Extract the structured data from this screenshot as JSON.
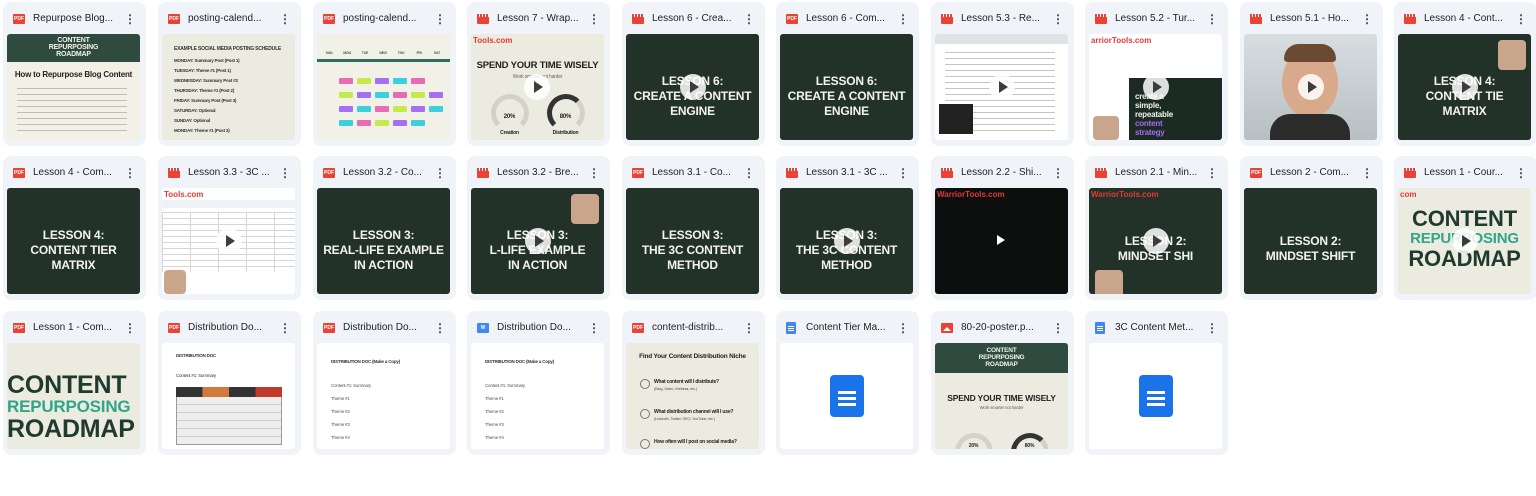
{
  "colors": {
    "card_bg": "#f0f4f9",
    "pdf_red": "#ea4335",
    "doc_blue": "#1a73e8",
    "dark_green": "#233229",
    "cream": "#ecebdf"
  },
  "files": [
    {
      "title": "Repurpose Blog...",
      "type": "pdf",
      "icon": "pdf-icon",
      "thumb": {
        "kind": "doc_green",
        "lines": [
          "CONTENT",
          "REPURPOSING",
          "ROADMAP"
        ],
        "heading": "How to Repurpose Blog Content"
      }
    },
    {
      "title": "posting-calend...",
      "type": "pdf",
      "icon": "pdf-icon",
      "thumb": {
        "kind": "schedule",
        "heading": "EXAMPLE SOCIAL MEDIA POSTING SCHEDULE",
        "rows": [
          "MONDAY: Summary Post (Post 1)",
          "TUESDAY: Theme #1 (Post 1)",
          "WEDNESDAY: Summary Post #2",
          "THURSDAY: Theme #1 (Post 2)",
          "FRIDAY: Summary Post (Post 3)",
          "SATURDAY: Optional",
          "SUNDAY: Optional",
          "MONDAY: Theme #1 (Post 3)"
        ]
      }
    },
    {
      "title": "posting-calend...",
      "type": "pdf",
      "icon": "pdf-icon",
      "thumb": {
        "kind": "calendar",
        "days": [
          "SUN",
          "MON",
          "TUE",
          "WED",
          "THU",
          "FRI",
          "SAT"
        ]
      }
    },
    {
      "title": "Lesson 7 - Wrap...",
      "type": "video",
      "icon": "video-icon",
      "thumb": {
        "kind": "spend",
        "brand": "Tools.com",
        "heading": "SPEND YOUR TIME WISELY",
        "sub": "Work smarter not harder",
        "left_pct": "20%",
        "right_pct": "80%",
        "left_label": "Creation",
        "right_label": "Distribution"
      }
    },
    {
      "title": "Lesson 6 - Crea...",
      "type": "video",
      "icon": "video-icon",
      "thumb": {
        "kind": "lesson_dark",
        "lines": [
          "LESSON 6:",
          "CREATE A CONTENT",
          "ENGINE"
        ],
        "play": true
      }
    },
    {
      "title": "Lesson 6 - Com...",
      "type": "pdf",
      "icon": "pdf-icon",
      "thumb": {
        "kind": "lesson_dark",
        "lines": [
          "LESSON 6:",
          "CREATE A CONTENT",
          "ENGINE"
        ],
        "play": false
      }
    },
    {
      "title": "Lesson 5.3 - Re...",
      "type": "video",
      "icon": "video-icon",
      "thumb": {
        "kind": "screen_recording",
        "play": true
      }
    },
    {
      "title": "Lesson 5.2 - Tur...",
      "type": "video",
      "icon": "video-icon",
      "thumb": {
        "kind": "strategy",
        "brand": "arriorTools.com",
        "lines": [
          "create a",
          "simple,",
          "repeatable"
        ],
        "accent": [
          "content",
          "strategy"
        ]
      }
    },
    {
      "title": "Lesson 5.1 - Ho...",
      "type": "video",
      "icon": "video-icon",
      "thumb": {
        "kind": "presenter",
        "play": true
      }
    },
    {
      "title": "Lesson 4 - Cont...",
      "type": "video",
      "icon": "video-icon",
      "thumb": {
        "kind": "lesson_dark_face",
        "lines": [
          "LESSON 4:",
          "CONTENT TIE",
          "MATRIX"
        ],
        "play": true
      }
    },
    {
      "title": "Lesson 4 - Com...",
      "type": "pdf",
      "icon": "pdf-icon",
      "thumb": {
        "kind": "lesson_dark",
        "lines": [
          "LESSON 4:",
          "CONTENT TIER",
          "MATRIX"
        ],
        "play": false
      }
    },
    {
      "title": "Lesson 3.3 - 3C ...",
      "type": "video",
      "icon": "video-icon",
      "thumb": {
        "kind": "spreadsheet",
        "brand": "Tools.com",
        "play": true
      }
    },
    {
      "title": "Lesson 3.2 - Co...",
      "type": "pdf",
      "icon": "pdf-icon",
      "thumb": {
        "kind": "lesson_dark",
        "lines": [
          "LESSON 3:",
          "REAL-LIFE EXAMPLE",
          "IN ACTION"
        ],
        "play": false
      }
    },
    {
      "title": "Lesson 3.2 - Bre...",
      "type": "video",
      "icon": "video-icon",
      "thumb": {
        "kind": "lesson_dark_face",
        "lines": [
          "LESSON 3:",
          "L-LIFE EXAMPLE",
          "IN ACTION"
        ],
        "play": true
      }
    },
    {
      "title": "Lesson 3.1 - Co...",
      "type": "pdf",
      "icon": "pdf-icon",
      "thumb": {
        "kind": "lesson_dark",
        "lines": [
          "LESSON 3:",
          "THE 3C CONTENT",
          "METHOD"
        ],
        "play": false
      }
    },
    {
      "title": "Lesson 3.1 - 3C ...",
      "type": "video",
      "icon": "video-icon",
      "thumb": {
        "kind": "lesson_dark",
        "lines": [
          "LESSON 3:",
          "THE 3C CONTENT",
          "METHOD"
        ],
        "play": true
      }
    },
    {
      "title": "Lesson 2.2 - Shi...",
      "type": "video",
      "icon": "video-icon",
      "thumb": {
        "kind": "black_video",
        "brand": "WarriorTools.com",
        "play": true
      }
    },
    {
      "title": "Lesson 2.1 - Min...",
      "type": "video",
      "icon": "video-icon",
      "thumb": {
        "kind": "lesson_dark_face",
        "brand": "WarriorTools.com",
        "lines": [
          "LESSON 2:",
          "MINDSET SHI"
        ],
        "play": true
      }
    },
    {
      "title": "Lesson 2 - Com...",
      "type": "pdf",
      "icon": "pdf-icon",
      "thumb": {
        "kind": "lesson_dark",
        "lines": [
          "LESSON 2:",
          "MINDSET SHIFT"
        ],
        "play": false
      }
    },
    {
      "title": "Lesson 1 - Cour...",
      "type": "video",
      "icon": "video-icon",
      "thumb": {
        "kind": "roadmap",
        "brand": "com",
        "lines": [
          "CONTENT",
          "REPURPOSING",
          "ROADMAP"
        ],
        "play": true
      }
    },
    {
      "title": "Lesson 1 - Com...",
      "type": "pdf",
      "icon": "pdf-icon",
      "thumb": {
        "kind": "roadmap_big",
        "lines": [
          "CONTENT",
          "REPURPOSING",
          "ROADMAP"
        ],
        "play": false
      }
    },
    {
      "title": "Distribution Do...",
      "type": "pdf",
      "icon": "pdf-icon",
      "thumb": {
        "kind": "dist_table",
        "heading": "DISTRIBUTION DOC",
        "sub": "Content #1: Summary"
      }
    },
    {
      "title": "Distribution Do...",
      "type": "pdf",
      "icon": "pdf-icon",
      "thumb": {
        "kind": "dist_doc",
        "heading": "DISTRIBUTION DOC (Make a Copy)",
        "rows": [
          "Content #1: Summary",
          "Theme #1",
          "Theme #2",
          "Theme #3",
          "Theme #4"
        ]
      }
    },
    {
      "title": "Distribution Do...",
      "type": "word",
      "icon": "word-icon",
      "thumb": {
        "kind": "dist_doc",
        "heading": "DISTRIBUTION DOC (Make a Copy)",
        "rows": [
          "Content #1: Summary",
          "Theme #1",
          "Theme #2",
          "Theme #3",
          "Theme #4"
        ]
      }
    },
    {
      "title": "content-distrib...",
      "type": "pdf",
      "icon": "pdf-icon",
      "thumb": {
        "kind": "niche",
        "heading": "Find Your Content Distribution Niche",
        "questions": [
          "What content will I distribute?",
          "What distribution channel will I use?",
          "How often will I post on social media?"
        ],
        "hints": [
          "(Blog, Video, Webinar, etc.)",
          "(LinkedIn, Twitter, SEO, YouTube, etc.)",
          ""
        ]
      }
    },
    {
      "title": "Content Tier Ma...",
      "type": "doc",
      "icon": "doc-icon",
      "thumb": {
        "kind": "doc_placeholder"
      }
    },
    {
      "title": "80-20-poster.p...",
      "type": "image",
      "icon": "image-icon",
      "thumb": {
        "kind": "poster",
        "lines": [
          "CONTENT",
          "REPURPOSING",
          "ROADMAP"
        ],
        "heading": "SPEND YOUR TIME WISELY",
        "sub": "Work smarter not harder",
        "left_pct": "20%",
        "right_pct": "80%"
      }
    },
    {
      "title": "3C Content Met...",
      "type": "doc",
      "icon": "doc-icon",
      "thumb": {
        "kind": "doc_placeholder"
      }
    }
  ]
}
